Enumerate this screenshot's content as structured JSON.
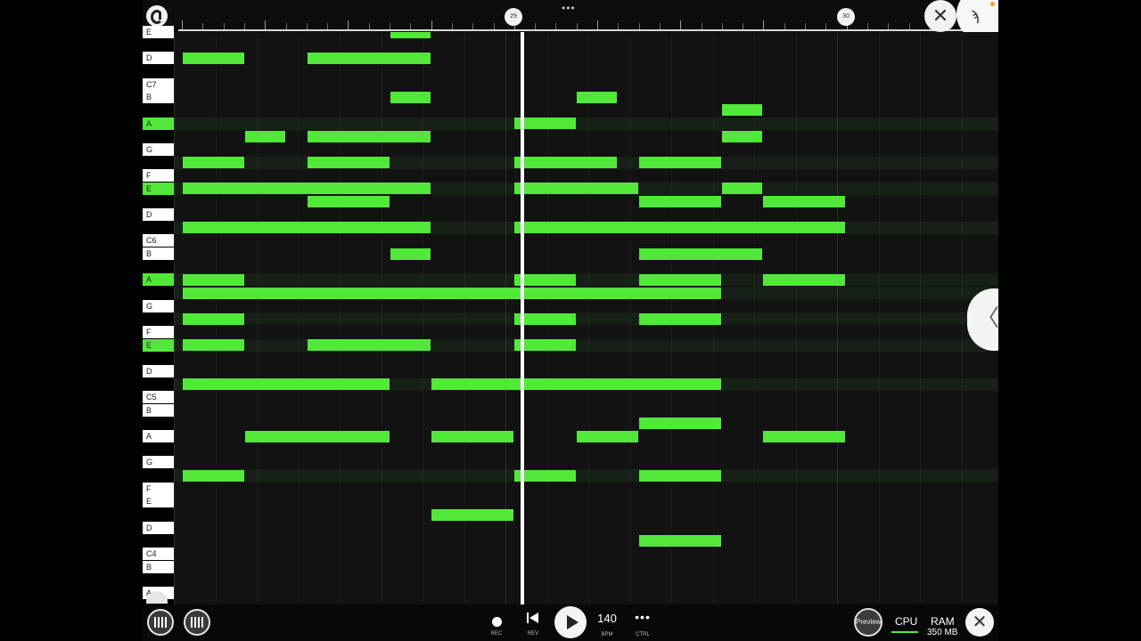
{
  "timeline": {
    "bar_markers": [
      "29",
      "30"
    ],
    "menu_dots": "•••"
  },
  "header": {
    "close_symbol": "✕",
    "app_logo_glyph": "ϡ"
  },
  "keyboard": {
    "keys": [
      {
        "label": "E",
        "color": "white"
      },
      {
        "label": "D",
        "color": "white"
      },
      {
        "label": "C7",
        "color": "white"
      },
      {
        "label": "B",
        "color": "white"
      },
      {
        "label": "A",
        "color": "lit"
      },
      {
        "label": "G",
        "color": "white"
      },
      {
        "label": "F",
        "color": "white"
      },
      {
        "label": "E",
        "color": "lit"
      },
      {
        "label": "D",
        "color": "white"
      },
      {
        "label": "C6",
        "color": "white"
      },
      {
        "label": "B",
        "color": "white"
      },
      {
        "label": "A",
        "color": "lit"
      },
      {
        "label": "G",
        "color": "white"
      },
      {
        "label": "F",
        "color": "white"
      },
      {
        "label": "E",
        "color": "lit"
      },
      {
        "label": "D",
        "color": "white"
      },
      {
        "label": "C5",
        "color": "white"
      },
      {
        "label": "B",
        "color": "white"
      },
      {
        "label": "A",
        "color": "white"
      },
      {
        "label": "G",
        "color": "white"
      },
      {
        "label": "F",
        "color": "white"
      },
      {
        "label": "E",
        "color": "white"
      },
      {
        "label": "D",
        "color": "white"
      },
      {
        "label": "C4",
        "color": "white"
      },
      {
        "label": "B",
        "color": "white"
      },
      {
        "label": "A",
        "color": "white"
      }
    ]
  },
  "piano_roll": {
    "note_color": "#52e83a",
    "playhead_color": "#ffffff",
    "notes": [
      {
        "pitch": "E7",
        "start": 5,
        "len": 1
      },
      {
        "pitch": "D7",
        "start": 0,
        "len": 1.5
      },
      {
        "pitch": "D7",
        "start": 3,
        "len": 3
      },
      {
        "pitch": "B6",
        "start": 5,
        "len": 1
      },
      {
        "pitch": "B6",
        "start": 9.5,
        "len": 1
      },
      {
        "pitch": "A#6",
        "start": 13,
        "len": 1
      },
      {
        "pitch": "A6",
        "start": 8,
        "len": 1.5
      },
      {
        "pitch": "G#6",
        "start": 1.5,
        "len": 1
      },
      {
        "pitch": "G#6",
        "start": 3,
        "len": 3
      },
      {
        "pitch": "G#6",
        "start": 13,
        "len": 1
      },
      {
        "pitch": "F#6",
        "start": 0,
        "len": 1.5
      },
      {
        "pitch": "F#6",
        "start": 3,
        "len": 2
      },
      {
        "pitch": "F#6",
        "start": 8,
        "len": 2.5
      },
      {
        "pitch": "F#6",
        "start": 11,
        "len": 2
      },
      {
        "pitch": "E6",
        "start": 0,
        "len": 6
      },
      {
        "pitch": "E6",
        "start": 8,
        "len": 3
      },
      {
        "pitch": "E6",
        "start": 13,
        "len": 1
      },
      {
        "pitch": "D#6",
        "start": 3,
        "len": 2
      },
      {
        "pitch": "D#6",
        "start": 11,
        "len": 2
      },
      {
        "pitch": "D#6",
        "start": 14,
        "len": 2
      },
      {
        "pitch": "C#6",
        "start": 0,
        "len": 6
      },
      {
        "pitch": "C#6",
        "start": 8,
        "len": 8
      },
      {
        "pitch": "B5",
        "start": 5,
        "len": 1
      },
      {
        "pitch": "B5",
        "start": 11,
        "len": 3
      },
      {
        "pitch": "A5",
        "start": 0,
        "len": 1.5
      },
      {
        "pitch": "A5",
        "start": 8,
        "len": 1.5
      },
      {
        "pitch": "A5",
        "start": 11,
        "len": 2
      },
      {
        "pitch": "A5",
        "start": 14,
        "len": 2
      },
      {
        "pitch": "G#5",
        "start": 0,
        "len": 13
      },
      {
        "pitch": "F#5",
        "start": 0,
        "len": 1.5
      },
      {
        "pitch": "F#5",
        "start": 8,
        "len": 1.5
      },
      {
        "pitch": "F#5",
        "start": 11,
        "len": 2
      },
      {
        "pitch": "E5",
        "start": 0,
        "len": 1.5
      },
      {
        "pitch": "E5",
        "start": 3,
        "len": 3
      },
      {
        "pitch": "E5",
        "start": 8,
        "len": 1.5
      },
      {
        "pitch": "C#5",
        "start": 0,
        "len": 5
      },
      {
        "pitch": "C#5",
        "start": 6,
        "len": 7
      },
      {
        "pitch": "A#4",
        "start": 11,
        "len": 2
      },
      {
        "pitch": "A4",
        "start": 1.5,
        "len": 3.5
      },
      {
        "pitch": "A4",
        "start": 6,
        "len": 2
      },
      {
        "pitch": "A4",
        "start": 9.5,
        "len": 1.5
      },
      {
        "pitch": "A4",
        "start": 14,
        "len": 2
      },
      {
        "pitch": "F#4",
        "start": 0,
        "len": 1.5
      },
      {
        "pitch": "F#4",
        "start": 8,
        "len": 1.5
      },
      {
        "pitch": "F#4",
        "start": 11,
        "len": 2
      },
      {
        "pitch": "D#4",
        "start": 6,
        "len": 2
      },
      {
        "pitch": "C#4",
        "start": 11,
        "len": 2
      }
    ],
    "highlight_rows": [
      "A6",
      "F#6",
      "E6",
      "C#6",
      "A5",
      "G#5",
      "F#5",
      "E5",
      "C#5",
      "F#4"
    ],
    "playhead_beat": 8.2
  },
  "transport": {
    "rec_label": "REC",
    "rev_label": "REV",
    "bpm_value": "140",
    "bpm_label": "BPM",
    "ctrl_symbol": "•••",
    "ctrl_label": "CTRL",
    "preview_label": "Preview",
    "cpu_label": "CPU",
    "ram_label": "RAM",
    "ram_value": "350 MB",
    "close_symbol": "✕"
  },
  "side_tab": {
    "chevron_symbol": "〈"
  }
}
